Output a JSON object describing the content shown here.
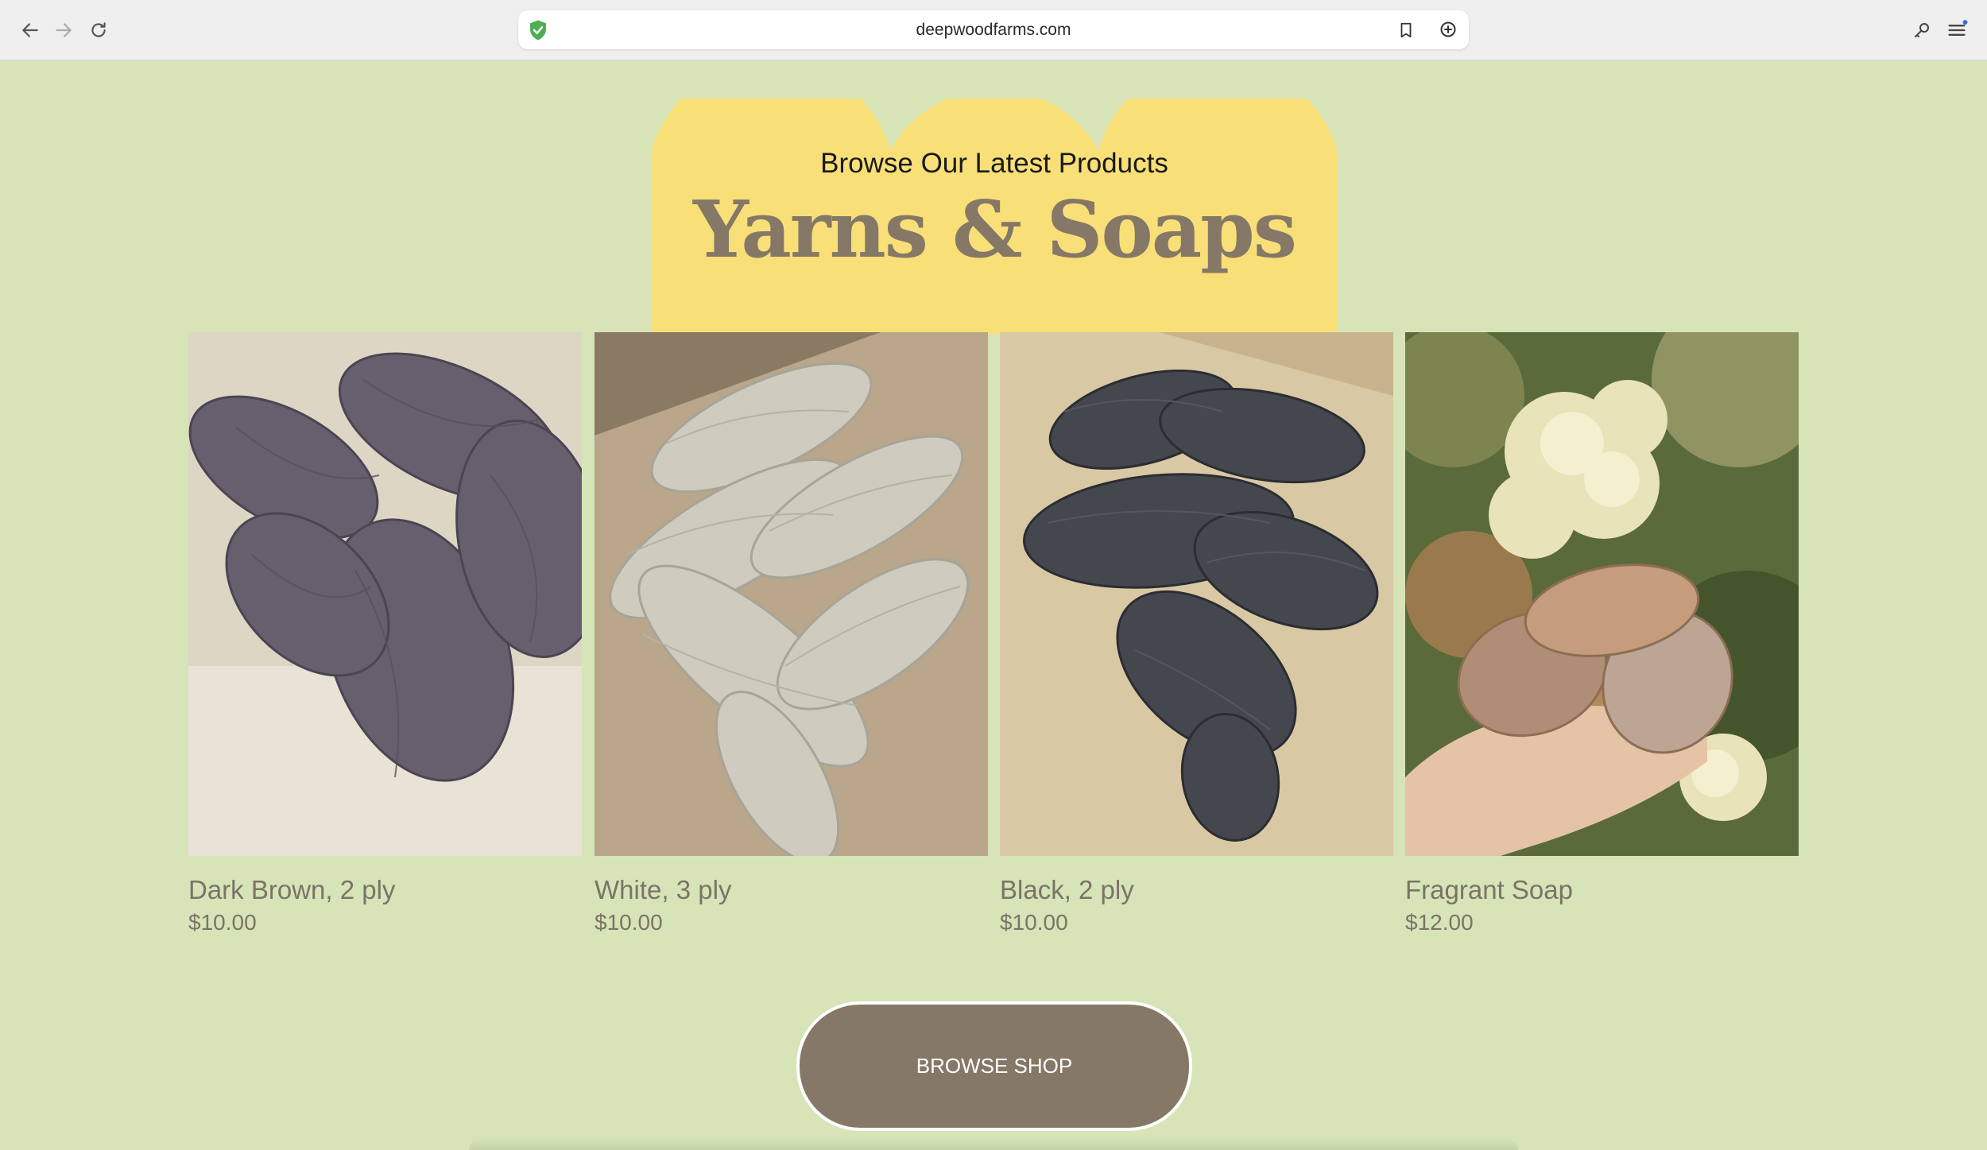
{
  "browser": {
    "url": "deepwoodfarms.com",
    "icons": {
      "back": "arrow-left-icon",
      "forward": "arrow-right-icon",
      "reload": "reload-icon",
      "security": "shield-check-icon",
      "bookmark": "bookmark-icon",
      "chat": "chat-plus-icon",
      "key": "key-icon",
      "menu": "menu-icon"
    },
    "colors": {
      "shield": "#4caf50",
      "notification_dot": "#2f6fdf"
    }
  },
  "hero": {
    "subtitle": "Browse Our Latest Products",
    "title": "Yarns & Soaps",
    "colors": {
      "blob": "#f8df78",
      "title": "#857866"
    }
  },
  "products": [
    {
      "name": "Dark Brown, 2 ply",
      "price": "$10.00",
      "image": "dark-yarn-skeins"
    },
    {
      "name": "White, 3 ply",
      "price": "$10.00",
      "image": "white-yarn-skeins"
    },
    {
      "name": "Black, 2 ply",
      "price": "$10.00",
      "image": "black-yarn-skeins"
    },
    {
      "name": "Fragrant Soap",
      "price": "$12.00",
      "image": "soap-bars-in-hand"
    }
  ],
  "cta": {
    "label": "BROWSE SHOP"
  },
  "theme": {
    "background": "#d6e4b8",
    "accent": "#857866"
  }
}
